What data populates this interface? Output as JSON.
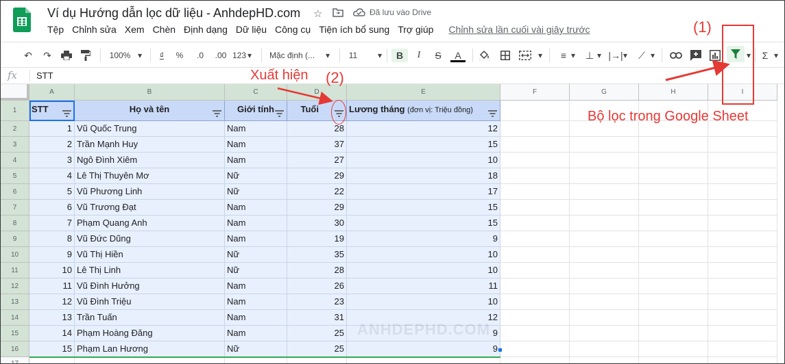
{
  "app": {
    "title": "Ví dụ Hướng dẫn lọc dữ liệu - AnhdepHD.com",
    "saved_status": "Đã lưu vào Drive",
    "menu": [
      "Tệp",
      "Chỉnh sửa",
      "Xem",
      "Chèn",
      "Định dạng",
      "Dữ liệu",
      "Công cụ",
      "Tiện ích bổ sung",
      "Trợ giúp"
    ],
    "last_edit": "Chỉnh sửa lần cuối vài giây trước"
  },
  "toolbar": {
    "zoom": "100%",
    "currency": "₫",
    "percent": "%",
    "dec_less": ".0",
    "dec_more": ".00",
    "more_formats": "123",
    "font": "Mặc định (...",
    "font_size": "11",
    "bold": "B",
    "italic": "I",
    "strike": "S",
    "text_color": "A",
    "sum": "Σ"
  },
  "formula_bar": {
    "fx": "fx",
    "value": "STT"
  },
  "columns": [
    "A",
    "B",
    "C",
    "D",
    "E",
    "F",
    "G",
    "H",
    "I"
  ],
  "rows": [
    "1",
    "2",
    "3",
    "4",
    "5",
    "6",
    "7",
    "8",
    "9",
    "10",
    "11",
    "12",
    "13",
    "14",
    "15",
    "16",
    "17"
  ],
  "table": {
    "headers": [
      "STT",
      "Họ và tên",
      "Giới tính",
      "Tuổi",
      "Lương tháng"
    ],
    "salary_note": "(đơn vị: Triệu đồng)",
    "rows": [
      [
        "1",
        "Vũ Quốc Trung",
        "Nam",
        "28",
        "12"
      ],
      [
        "2",
        "Trần Mạnh Huy",
        "Nam",
        "37",
        "15"
      ],
      [
        "3",
        "Ngô Đình Xiêm",
        "Nam",
        "27",
        "10"
      ],
      [
        "4",
        "Lê Thị Thuyên Mơ",
        "Nữ",
        "29",
        "18"
      ],
      [
        "5",
        "Vũ Phương Linh",
        "Nữ",
        "22",
        "17"
      ],
      [
        "6",
        "Vũ Trương Đạt",
        "Nam",
        "29",
        "15"
      ],
      [
        "7",
        "Phạm Quang Anh",
        "Nam",
        "30",
        "15"
      ],
      [
        "8",
        "Vũ Đức Dũng",
        "Nam",
        "19",
        "9"
      ],
      [
        "9",
        "Vũ Thị Hiền",
        "Nữ",
        "35",
        "10"
      ],
      [
        "10",
        "Lê Thị Linh",
        "Nữ",
        "28",
        "10"
      ],
      [
        "11",
        "Vũ Đình Hưởng",
        "Nam",
        "26",
        "11"
      ],
      [
        "12",
        "Vũ Đình Triệu",
        "Nam",
        "23",
        "10"
      ],
      [
        "13",
        "Trần Tuấn",
        "Nam",
        "31",
        "12"
      ],
      [
        "14",
        "Phạm Hoàng Đăng",
        "Nam",
        "25",
        "9"
      ],
      [
        "15",
        "Phạm Lan Hương",
        "Nữ",
        "25",
        "9"
      ]
    ]
  },
  "annotations": {
    "label_1": "(1)",
    "label_2": "(2)",
    "appear": "Xuất hiện",
    "filter_caption": "Bộ lọc trong Google Sheet"
  },
  "watermark": "ANHDEPHD.COM",
  "colors": {
    "accent_red": "#e53935",
    "header_fill": "#c9daf8",
    "data_fill": "#e8f0fe",
    "filter_green": "#188038"
  }
}
